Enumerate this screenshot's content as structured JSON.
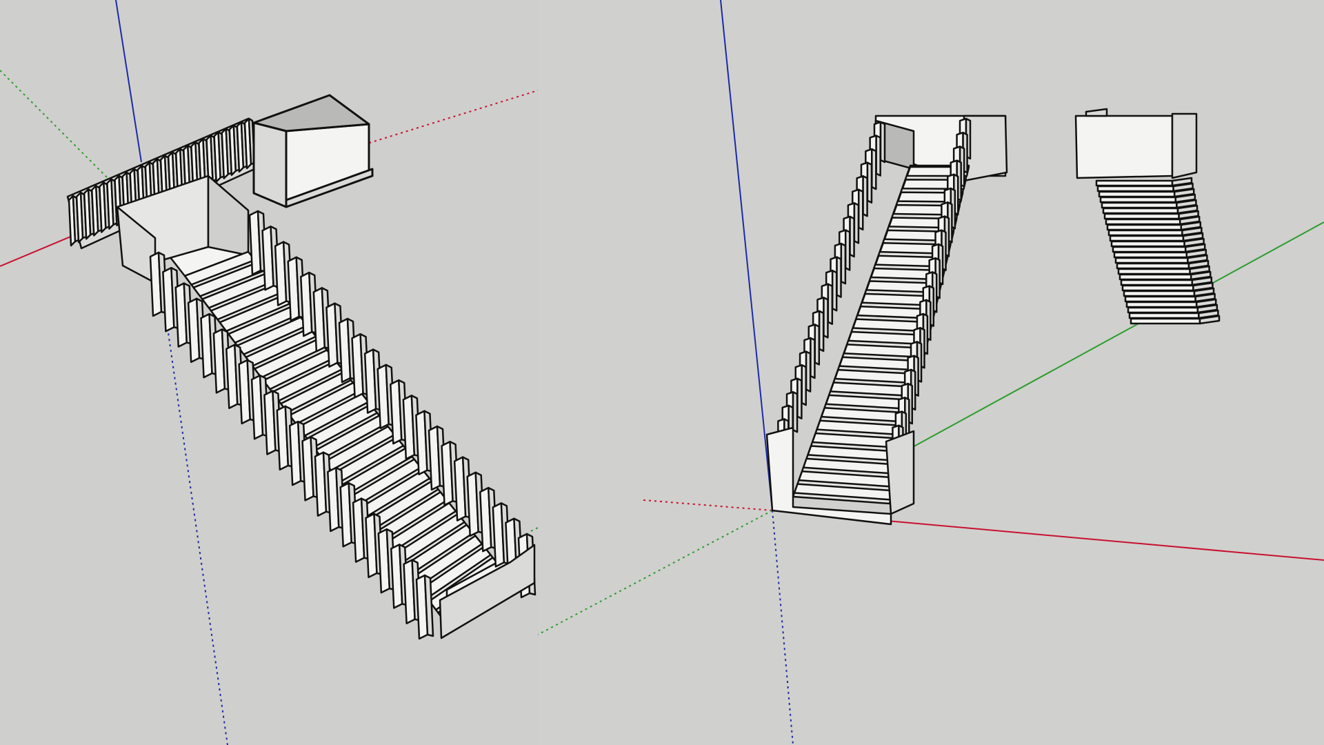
{
  "colors": {
    "background": "#cfcfcd",
    "axis_red": "#c8102e",
    "axis_green": "#2a9d2a",
    "axis_blue": "#1a2aa8",
    "face_light": "#f4f4f2",
    "face_mid": "#dadad8",
    "face_dark": "#b9b9b7",
    "edge": "#111111"
  },
  "viewports": [
    {
      "name": "left-viewport",
      "icons": [
        "staircase-model",
        "rail-model",
        "landing-box-model"
      ]
    },
    {
      "name": "right-viewport",
      "icons": [
        "staircase-model",
        "stair-profile-model"
      ]
    }
  ]
}
